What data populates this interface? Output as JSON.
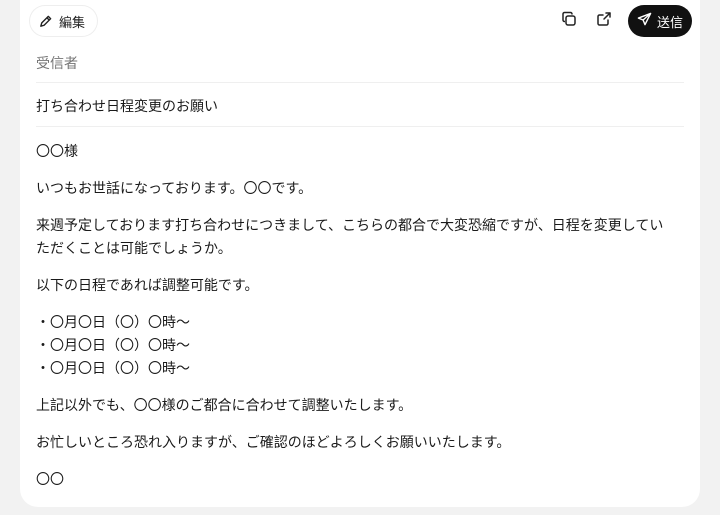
{
  "toolbar": {
    "edit_label": "編集",
    "send_label": "送信",
    "icons": {
      "edit": "pencil-icon",
      "copy": "copy-icon",
      "share": "external-link-icon",
      "send": "paper-plane-icon"
    }
  },
  "email": {
    "to_placeholder": "受信者",
    "subject": "打ち合わせ日程変更のお願い",
    "greeting": "〇〇様",
    "intro": "いつもお世話になっております。〇〇です。",
    "request": "来週予定しております打ち合わせにつきまして、こちらの都合で大変恐縮ですが、日程を変更していただくことは可能でしょうか。",
    "options_intro": "以下の日程であれば調整可能です。",
    "options": [
      "・〇月〇日（〇）〇時〜",
      "・〇月〇日（〇）〇時〜",
      "・〇月〇日（〇）〇時〜"
    ],
    "flexibility": "上記以外でも、〇〇様のご都合に合わせて調整いたします。",
    "closing": "お忙しいところ恐れ入りますが、ご確認のほどよろしくお願いいたします。",
    "signature": "〇〇"
  },
  "colors": {
    "send_button_bg": "#111111",
    "placeholder": "#9a9a9a",
    "background": "#f2f2f2"
  }
}
